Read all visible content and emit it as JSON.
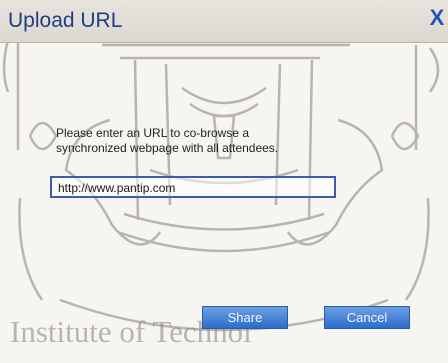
{
  "dialog": {
    "title": "Upload URL",
    "close_label": "X"
  },
  "prompt": {
    "line1": "Please enter an URL to co-browse a",
    "line2": "synchronized webpage with all attendees."
  },
  "url": {
    "value": "http://www.pantip.com",
    "placeholder": ""
  },
  "buttons": {
    "share_label": "Share",
    "cancel_label": "Cancel"
  },
  "watermark": {
    "text": "Institute of Technol"
  },
  "colors": {
    "title": "#1f3f83",
    "button_top": "#6e9fe2",
    "button_bottom": "#2b6ccd",
    "input_border": "#3c5ea8",
    "watermark": "#8d8a86"
  }
}
